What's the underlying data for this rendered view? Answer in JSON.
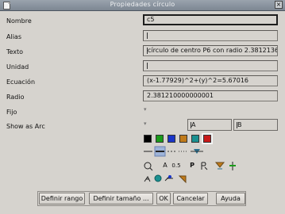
{
  "window": {
    "title": "Propiedades círculo"
  },
  "fields": {
    "nombre": {
      "label": "Nombre",
      "value": "c5"
    },
    "alias": {
      "label": "Alias",
      "value": ""
    },
    "texto": {
      "label": "Texto",
      "value": "círculo de centro P6 con radio 2.3812136"
    },
    "unidad": {
      "label": "Unidad",
      "value": ""
    },
    "ecuacion": {
      "label": "Ecuación",
      "value": "(x-1.77929)^2+(y)^2=5.67016"
    },
    "radio": {
      "label": "Radio",
      "value": "2.381210000000001"
    },
    "fijo": {
      "label": "Fijo"
    },
    "show_as_arc": {
      "label": "Show as Arc",
      "start_value": "A",
      "end_value": "B"
    }
  },
  "palette": {
    "colors": [
      "#000000",
      "#1a9b1a",
      "#1a35c8",
      "#c07a1a",
      "#1a9090",
      "#c81a1a"
    ],
    "selected_index": 5
  },
  "tools": {
    "text_size": "0.5",
    "text_p": "P",
    "text_a": "A"
  },
  "buttons": {
    "definir_rango": "Definir rango",
    "definir_tamano": "Definir tamaño ...",
    "ok": "OK",
    "cancelar": "Cancelar",
    "ayuda": "Ayuda"
  }
}
